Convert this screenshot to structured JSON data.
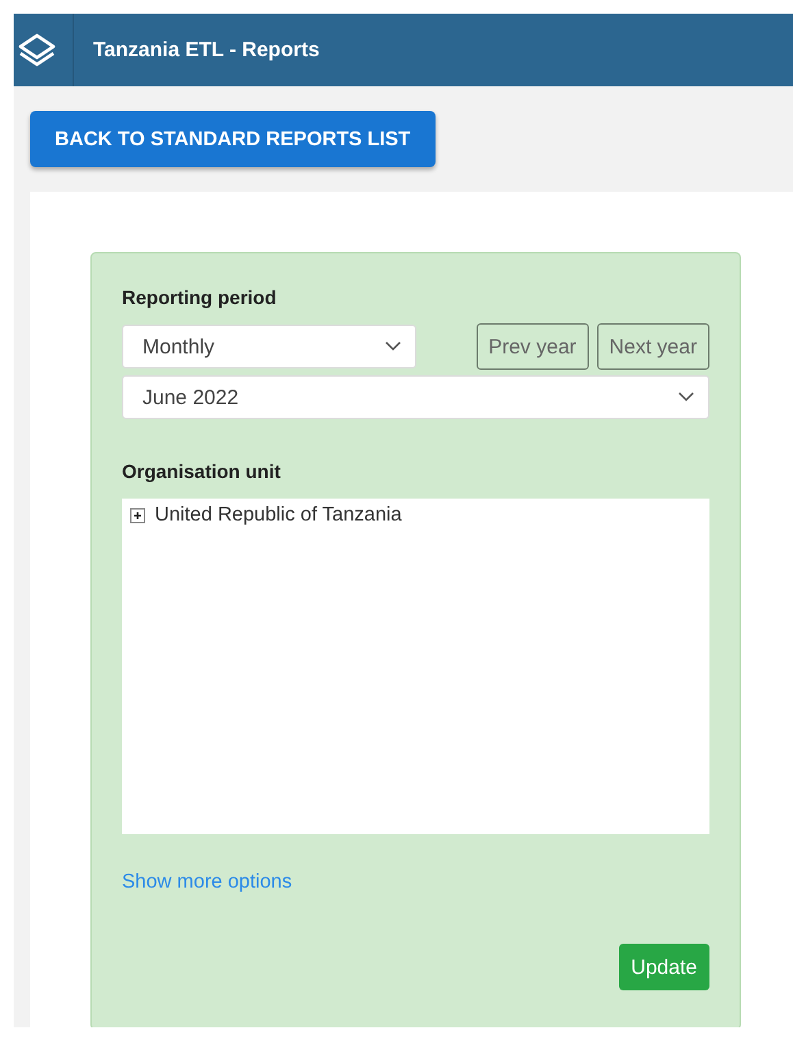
{
  "header": {
    "title": "Tanzania ETL - Reports"
  },
  "back_button": "BACK TO STANDARD REPORTS LIST",
  "form": {
    "period_label": "Reporting period",
    "period_type": {
      "value": "Monthly"
    },
    "year_buttons": [
      "Prev year",
      "Next year"
    ],
    "period": {
      "value": "June 2022"
    },
    "org_unit_label": "Organisation unit",
    "org_tree": [
      {
        "label": "United Republic of Tanzania",
        "expanded": false
      }
    ],
    "more_options_link": "Show more options",
    "update_button": "Update"
  }
}
